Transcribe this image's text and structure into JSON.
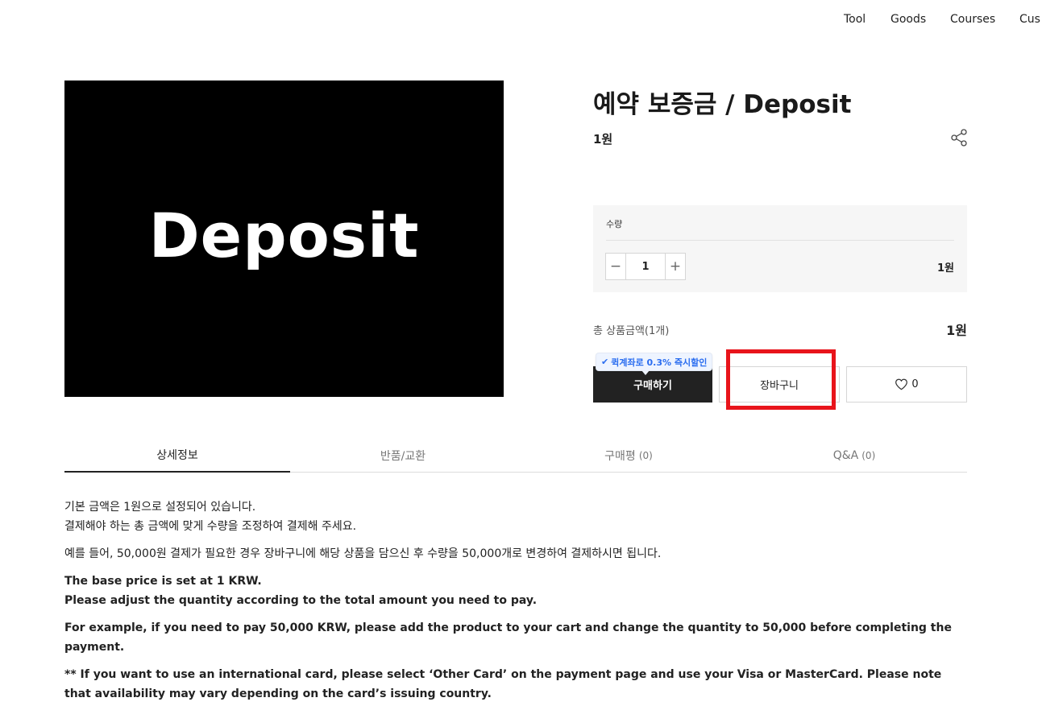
{
  "nav": {
    "items": [
      "Tool",
      "Goods",
      "Courses",
      "Cus"
    ]
  },
  "product": {
    "image_text": "Deposit",
    "title": "예약 보증금 / Deposit",
    "price": "1원",
    "share_icon": "share-icon"
  },
  "quantity": {
    "label": "수량",
    "minus": "−",
    "value": "1",
    "plus": "+",
    "line_price": "1원"
  },
  "total": {
    "label": "총 상품금액(1개)",
    "value": "1원"
  },
  "promo": {
    "check": "✔",
    "text": "퀵계좌로 0.3% 즉시할인",
    "color": "#2a6df0"
  },
  "actions": {
    "buy_label": "구매하기",
    "cart_label": "장바구니",
    "wish_count": "0",
    "highlight_color": "#e8141b"
  },
  "tabs": [
    {
      "label": "상세정보",
      "count": ""
    },
    {
      "label": "반품/교환",
      "count": ""
    },
    {
      "label": "구매평",
      "count": "(0)"
    },
    {
      "label": "Q&A",
      "count": "(0)"
    }
  ],
  "description": {
    "ko_line1": "기본 금액은 1원으로 설정되어 있습니다.",
    "ko_line2": "결제해야 하는 총 금액에 맞게 수량을 조정하여 결제해 주세요.",
    "ko_example": "예를 들어, 50,000원 결제가 필요한 경우 장바구니에 해당 상품을 담으신 후 수량을 50,000개로 변경하여 결제하시면 됩니다.",
    "en_line1": "The base price is set at 1 KRW.",
    "en_line2": "Please adjust the quantity according to the total amount you need to pay.",
    "en_example": "For example, if you need to pay 50,000 KRW, please add the product to your cart and change the quantity to 50,000 before completing the payment.",
    "en_note": "**  If you want to use an international card, please select ‘Other Card’ on the payment page and use your Visa or MasterCard. Please note that availability may vary depending on the card’s issuing country."
  }
}
